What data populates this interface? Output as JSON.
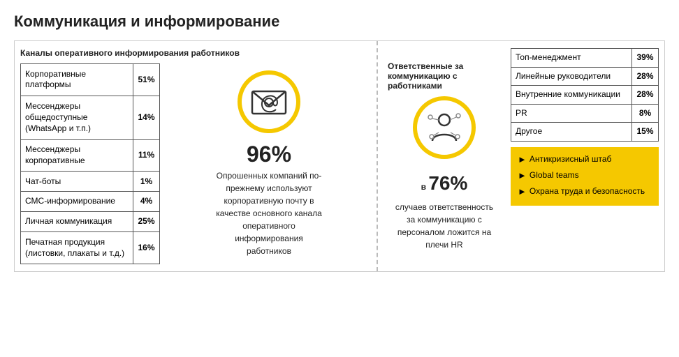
{
  "page": {
    "title": "Коммуникация и информирование"
  },
  "left_section": {
    "section_title": "Каналы оперативного информирования работников",
    "table_rows": [
      {
        "label": "Корпоративные платформы",
        "value": "51%"
      },
      {
        "label": "Мессенджеры общедоступные (WhatsApp и т.п.)",
        "value": "14%"
      },
      {
        "label": "Мессенджеры корпоративные",
        "value": "11%"
      },
      {
        "label": "Чат-боты",
        "value": "1%"
      },
      {
        "label": "СМС-информирование",
        "value": "4%"
      },
      {
        "label": "Личная коммуникация",
        "value": "25%"
      },
      {
        "label": "Печатная продукция (листовки, плакаты и т.д.)",
        "value": "16%"
      }
    ],
    "email_stat": "96%",
    "email_desc": "Опрошенных компаний по-прежнему используют корпоративную почту в качестве основного канала оперативного информирования работников"
  },
  "right_section": {
    "section_title": "Ответственные за коммуникацию с работниками",
    "person_stat_prefix": "в",
    "person_stat": "76%",
    "person_desc": "случаев ответственность за коммуникацию с персоналом ложится на плечи HR",
    "table_rows": [
      {
        "label": "Топ-менеджмент",
        "value": "39%"
      },
      {
        "label": "Линейные руководители",
        "value": "28%"
      },
      {
        "label": "Внутренние коммуникации",
        "value": "28%"
      },
      {
        "label": "PR",
        "value": "8%"
      },
      {
        "label": "Другое",
        "value": "15%"
      }
    ],
    "bullets": [
      "Антикризисный штаб",
      "Global teams",
      "Охрана труда и безопасность"
    ]
  }
}
